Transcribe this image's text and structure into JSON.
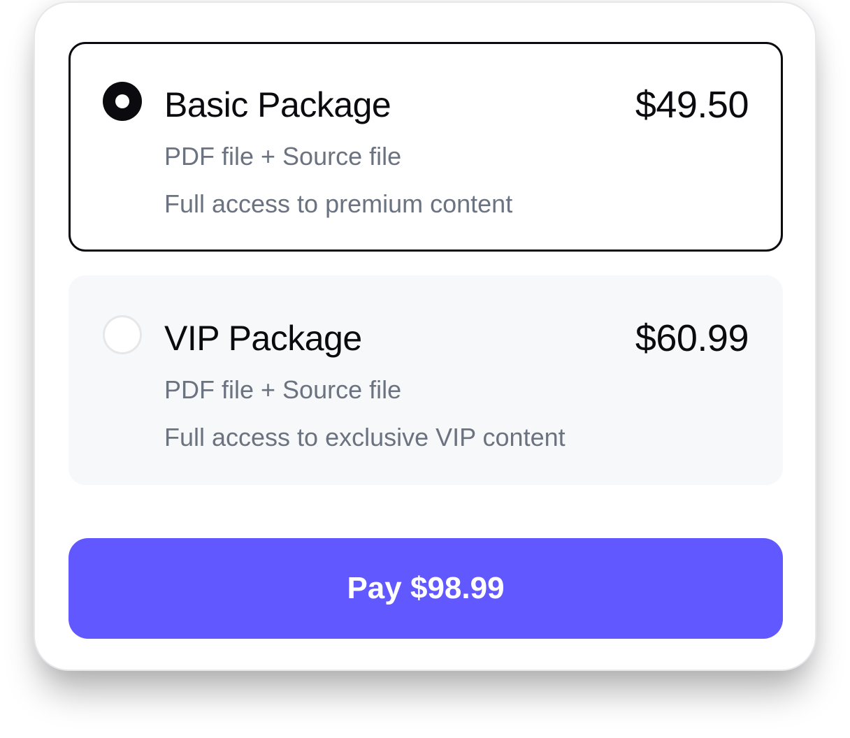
{
  "packages": [
    {
      "title": "Basic Package",
      "price": "$49.50",
      "features": [
        "PDF file + Source file",
        "Full access to premium content"
      ],
      "selected": true
    },
    {
      "title": "VIP Package",
      "price": "$60.99",
      "features": [
        "PDF file + Source file",
        "Full access to exclusive VIP content"
      ],
      "selected": false
    }
  ],
  "pay_button": {
    "label": "Pay $98.99"
  },
  "colors": {
    "accent": "#6158ff",
    "text_primary": "#0b0b0f",
    "text_secondary": "#6b7280",
    "unselected_bg": "#f7f8fa"
  }
}
